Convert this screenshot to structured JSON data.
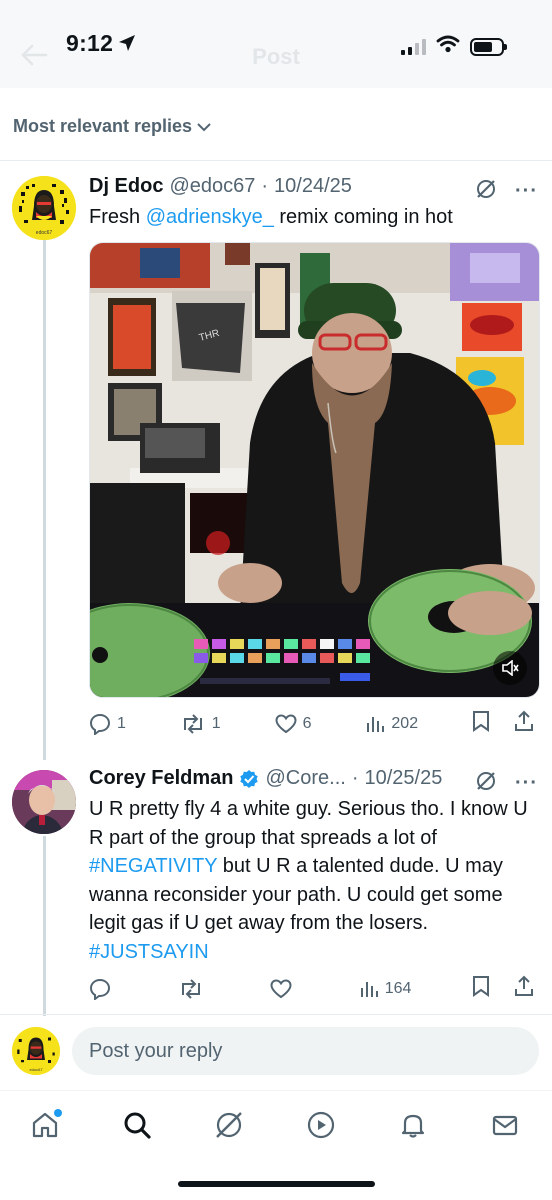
{
  "status_bar": {
    "time": "9:12"
  },
  "header": {
    "title": "Post"
  },
  "sort": {
    "label": "Most relevant replies"
  },
  "tweets": [
    {
      "name": "Dj Edoc",
      "handle": "@edoc67",
      "separator": "·",
      "date": "10/24/25",
      "avatar_caption": "edoc67",
      "text_before": "Fresh ",
      "mention": "@adrienskye_",
      "text_after": " remix coming in hot",
      "stats": {
        "replies": "1",
        "reposts": "1",
        "likes": "6",
        "views": "202"
      }
    },
    {
      "name": "Corey Feldman",
      "handle": "@Core...",
      "separator": "·",
      "date": "10/25/25",
      "verified": true,
      "text_1": "U R pretty fly 4 a white guy. Serious tho. I know U R part of the group that spreads a lot of ",
      "hashtag_1": "#NEGATIVITY",
      "text_2": " but U R a talented dude. U may wanna reconsider your path. U could get some legit gas if U get away from the losers. ",
      "hashtag_2": "#JUSTSAYIN",
      "stats": {
        "replies": "",
        "reposts": "",
        "likes": "",
        "views": "164"
      }
    }
  ],
  "reply_box": {
    "placeholder": "Post your reply",
    "avatar_caption": "edoc67"
  },
  "tabbar": {
    "tabs": [
      {
        "icon": "home-icon",
        "active": true
      },
      {
        "icon": "search-icon"
      },
      {
        "icon": "grok-icon"
      },
      {
        "icon": "play-icon"
      },
      {
        "icon": "bell-icon"
      },
      {
        "icon": "mail-icon"
      }
    ]
  },
  "colors": {
    "accent": "#1d9bf0",
    "text": "#0f1419",
    "secondary": "#536471",
    "verified": "#1d9bf0"
  }
}
